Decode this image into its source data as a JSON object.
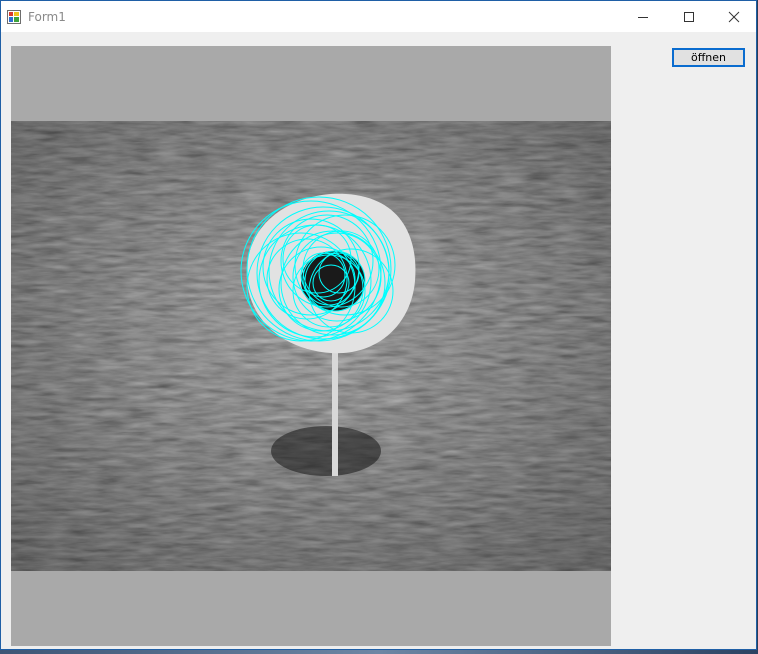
{
  "window": {
    "title": "Form1",
    "controls": {
      "minimize_icon": "minimize-icon",
      "maximize_icon": "maximize-icon",
      "close_icon": "close-icon"
    }
  },
  "toolbar": {
    "open_label": "öffnen"
  },
  "picture": {
    "description_icon": "grayscale-photo",
    "overlay_color": "#00ffff",
    "background_color": "#a9a9a9"
  },
  "colors": {
    "accent": "#0a6ccf",
    "window_border": "#1f5fa6"
  }
}
